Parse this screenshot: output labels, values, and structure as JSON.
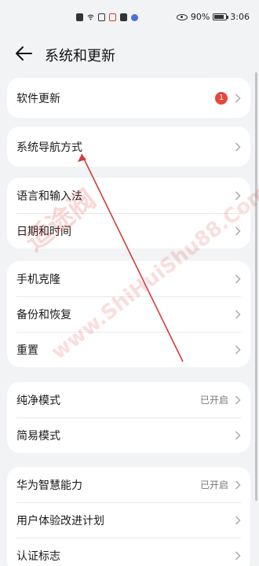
{
  "status_bar": {
    "battery": "90%",
    "time": "3:06",
    "icons": [
      "notification-icon",
      "wifi-icon",
      "hourglass-icon",
      "app-icon",
      "app-icon",
      "app-icon"
    ]
  },
  "header": {
    "title": "系统和更新",
    "back_icon": "arrow-left-icon"
  },
  "groups": [
    {
      "items": [
        {
          "label": "软件更新",
          "badge": "1"
        }
      ]
    },
    {
      "items": [
        {
          "label": "系统导航方式"
        }
      ]
    },
    {
      "items": [
        {
          "label": "语言和输入法"
        },
        {
          "label": "日期和时间"
        }
      ]
    },
    {
      "items": [
        {
          "label": "手机克隆"
        },
        {
          "label": "备份和恢复"
        },
        {
          "label": "重置"
        }
      ]
    },
    {
      "items": [
        {
          "label": "纯净模式",
          "value": "已开启"
        },
        {
          "label": "简易模式"
        }
      ]
    },
    {
      "items": [
        {
          "label": "华为智慧能力",
          "value": "已开启"
        },
        {
          "label": "用户体验改进计划"
        },
        {
          "label": "认证标志"
        }
      ]
    }
  ],
  "watermark": {
    "cn": "适途阀",
    "en": "www.ShiHuiShu88.Com"
  },
  "colors": {
    "background": "#f1f3f5",
    "card": "#ffffff",
    "badge": "#e8453c",
    "watermark": "#e64646",
    "annotation_line": "#d63b3b"
  }
}
